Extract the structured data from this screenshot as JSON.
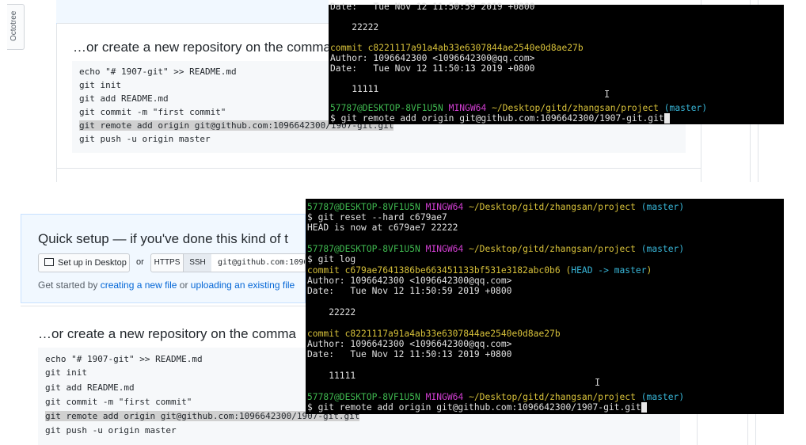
{
  "sidebar": {
    "octotree_label": "Octotree"
  },
  "top_panel": {
    "heading": "…or create a new repository on the comma",
    "code_lines": [
      "echo \"# 1907-git\" >> README.md",
      "git init",
      "git add README.md",
      "git commit -m \"first commit\"",
      "git remote add origin git@github.com:1096642300/1907-git.git",
      "git push -u origin master"
    ]
  },
  "terminal_top": {
    "l1_date": "Date:   Tue Nov 12 11:50:59 2019 +0800",
    "l2_msg": "    22222",
    "l3_commit": "commit c8221117a91a4ab33e6307844ae2540e0d8ae27b",
    "l4_author": "Author: 1096642300 <1096642300@qq.com>",
    "l5_date": "Date:   Tue Nov 12 11:50:13 2019 +0800",
    "l6_msg": "    11111",
    "prompt_user": "57787@DESKTOP-8VF1U5N",
    "prompt_shell": "MINGW64",
    "prompt_path": "~/Desktop/gitd/zhangsan/project",
    "prompt_branch": "(master)",
    "command": "$ git remote add origin git@github.com:1096642300/1907-git.git"
  },
  "bottom_panel": {
    "quick_setup_title": "Quick setup — if you've done this kind of t",
    "desktop_button": "Set up in Desktop",
    "or_text": "or",
    "https_label": "HTTPS",
    "ssh_label": "SSH",
    "url_value": "git@github.com:1096",
    "get_started_prefix": "Get started by ",
    "link_new_file": "creating a new file",
    "get_started_or": " or ",
    "link_upload": "uploading an existing file",
    "heading": "…or create a new repository on the comma",
    "code_lines": [
      "echo \"# 1907-git\" >> README.md",
      "git init",
      "git add README.md",
      "git commit -m \"first commit\"",
      "git remote add origin git@github.com:1096642300/1907-git.git",
      "git push -u origin master"
    ]
  },
  "terminal_bottom": {
    "prompt_user": "57787@DESKTOP-8VF1U5N",
    "prompt_shell": "MINGW64",
    "prompt_path": "~/Desktop/gitd/zhangsan/project",
    "prompt_branch": "(master)",
    "cmd_reset": "$ git reset --hard c679ae7",
    "head_now": "HEAD is now at c679ae7 22222",
    "cmd_log": "$ git log",
    "commit1": "commit c679ae7641386be663451133bf531e3182abc0b6",
    "commit1_ref_open": "(",
    "commit1_head": "HEAD -> master",
    "commit1_ref_close": ")",
    "author1": "Author: 1096642300 <1096642300@qq.com>",
    "date1": "Date:   Tue Nov 12 11:50:59 2019 +0800",
    "msg1": "    22222",
    "commit2": "commit c8221117a91a4ab33e6307844ae2540e0d8ae27b",
    "author2": "Author: 1096642300 <1096642300@qq.com>",
    "date2": "Date:   Tue Nov 12 11:50:13 2019 +0800",
    "msg2": "    11111",
    "command": "$ git remote add origin git@github.com:1096642300/1907-git.git"
  },
  "colors": {
    "prompt_user": "#3fb950",
    "prompt_shell": "#d23fd2",
    "prompt_path": "#d7c13a",
    "prompt_branch": "#38b6d8",
    "link": "#0366d6"
  }
}
